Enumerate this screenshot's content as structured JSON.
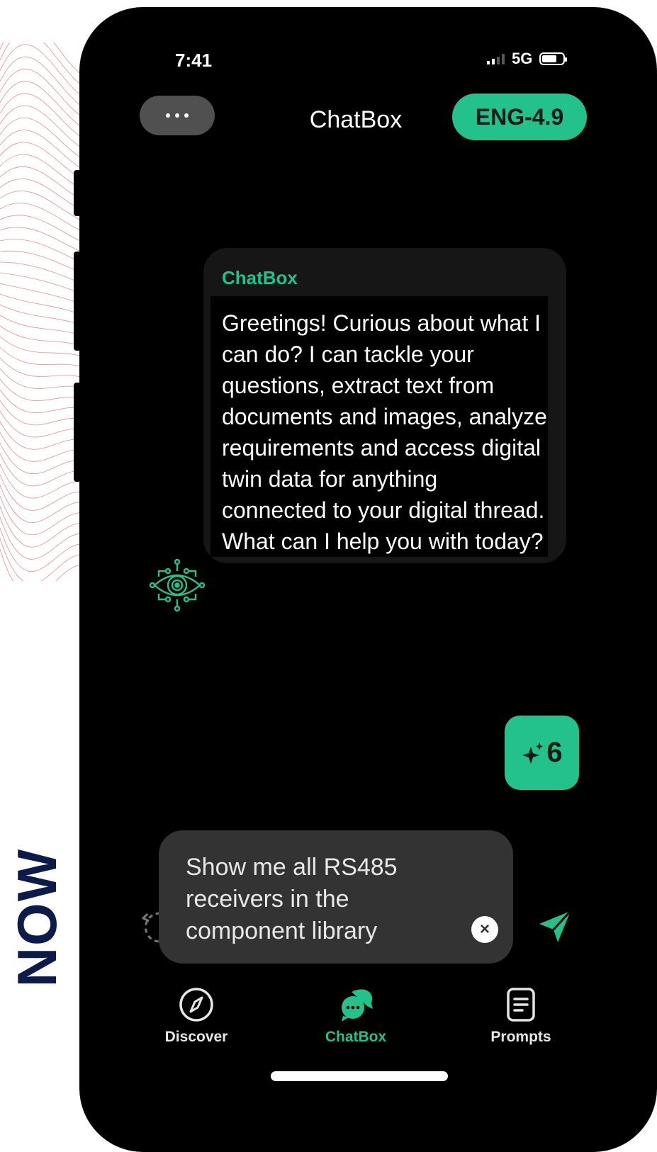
{
  "side_label": "NOW",
  "status_bar": {
    "time": "7:41",
    "network": "5G"
  },
  "header": {
    "menu_icon": "ellipsis-icon",
    "title": "ChatBox",
    "model_badge": "ENG-4.9"
  },
  "message": {
    "sender": "ChatBox",
    "text": "Greetings! Curious about what I can do? I can tackle your questions, extract text from documents and images, analyze requirements and access digital twin data for anything connected to your digital thread. What can I help you with today?",
    "avatar_icon": "circuit-eye-icon"
  },
  "prompt_credits": {
    "icon": "sparkle-icon",
    "count": "6"
  },
  "input": {
    "value": "Show me all RS485 receivers in the component library",
    "clear_icon": "close-icon",
    "send_icon": "send-icon"
  },
  "nav": {
    "items": [
      {
        "label": "Discover",
        "icon": "compass-icon",
        "active": false
      },
      {
        "label": "ChatBox",
        "icon": "chat-bubbles-icon",
        "active": true
      },
      {
        "label": "Prompts",
        "icon": "document-icon",
        "active": false
      }
    ]
  },
  "colors": {
    "accent": "#23c28c",
    "background": "#000000",
    "side_label": "#0d1b4b",
    "deco_lines": "#e07a84"
  }
}
